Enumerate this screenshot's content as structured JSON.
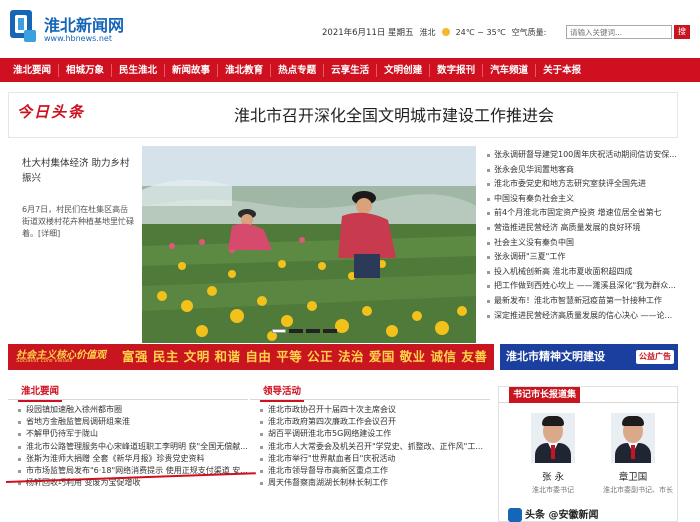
{
  "header": {
    "logo_text": "淮北新闻网",
    "logo_url": "www.hbnews.net",
    "date": "2021年6月11日 星期五",
    "city": "淮北",
    "weather": "24℃ ~ 35℃",
    "air": "空气质量:",
    "search_placeholder": "请输入关键词...",
    "search_button": "搜"
  },
  "nav": {
    "items": [
      "淮北要闻",
      "相城万象",
      "民生淮北",
      "新闻故事",
      "淮北教育",
      "热点专题",
      "云享生活",
      "文明创建",
      "数字报刊",
      "汽车频道",
      "关于本报"
    ]
  },
  "headline": {
    "tag": "今日头条",
    "title": "淮北市召开深化全国文明城市建设工作推进会"
  },
  "feature": {
    "title": "杜大村集体经济 助力乡村振兴",
    "desc": "6月7日，村民们在杜集区高岳街道双楼村花卉种植基地里忙碌着。[详细]"
  },
  "news_list": [
    "张永调研督导建党100周年庆祝活动期间信访安保...",
    "张永会见华润置地客商",
    "淮北市委党史和地方志研究室获评全国先进",
    "中国没有秦负社会主义",
    "前4个月淮北市固定资产投资 增速位居全省第七",
    "营造推进民营经济 高质量发展的良好环境",
    "社会主义没有秦负中国",
    "张永调研\"三夏\"工作",
    "投入机械创新高 淮北市夏收面积超四成",
    "把工作做到西姓心坎上 ——濉溪县深化\"我为群众...",
    "最新发布！淮北市智慧新冠疫苗第一针接种工作",
    "深定推进民营经济高质量发展的信心决心 ——论..."
  ],
  "banner_left": {
    "badge": "社会主义核心价值观",
    "badge_sub": "Socialist core values",
    "text": "富强 民主 文明 和谐 自由 平等 公正 法治 爱国 敬业 诚信 友善"
  },
  "banner_right": {
    "text": "淮北市精神文明建设",
    "badge": "公益广告"
  },
  "section_news": {
    "title": "淮北要闻",
    "items": [
      "段园镇加速融入徐州都市圈",
      "省地方金融监管局调研组来淮",
      "不解甲仍待军于陇山",
      "淮北市公路管理服务中心宋峰道班职工李明明 获\"全国无偿献...",
      "张斯为淮师大捐赠 全套《新华月报》珍贵党史资料",
      "市市场监管局发布\"6·18\"网络消费提示 使用正规支付渠道 安...",
      "杨轩回收巧利用 变废为宝促增收"
    ]
  },
  "section_leaders": {
    "title": "领导活动",
    "items": [
      "淮北市政协召开十届四十次主席会议",
      "淮北市政府第四次廉政工作会议召开",
      "胡百平调研淮北市5G网络建设工作",
      "淮北市人大常委会及机关召开\"学党史、抓整改、正作风\"工...",
      "淮北市举行\"世界献血者日\"庆祝活动",
      "淮北市领导督导市高新区重点工作",
      "周天伟督察南湖湖长制林长制工作"
    ]
  },
  "secretary": {
    "title": "书记市长报道集",
    "people": [
      {
        "name": "张 永",
        "role": "淮北市委书记"
      },
      {
        "name": "章卫国",
        "role": "淮北市委副书记、市长"
      }
    ]
  },
  "corner_logo": "头条 @安徽新闻"
}
